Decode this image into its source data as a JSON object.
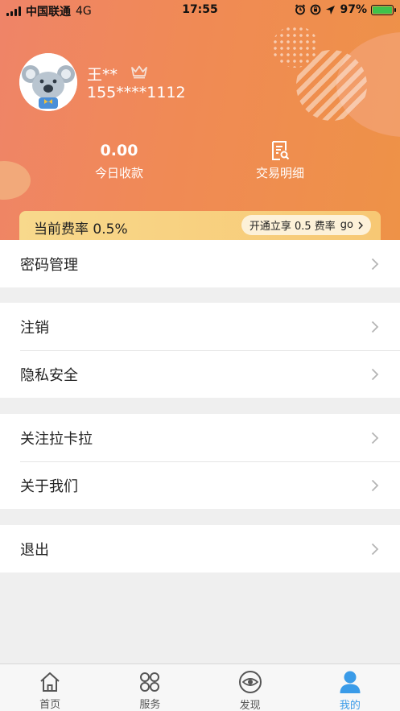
{
  "status_bar": {
    "carrier": "中国联通",
    "network": "4G",
    "time": "17:55",
    "battery": "97%"
  },
  "profile": {
    "name": "王**",
    "phone": "155****1112",
    "avatar_icon": "koala-avatar-icon",
    "vip_icon": "crown-icon"
  },
  "stats": {
    "today_amount": "0.00",
    "today_label": "今日收款",
    "detail_label": "交易明细",
    "detail_icon": "receipt-search-icon"
  },
  "rate": {
    "label": "当前费率 0.5%",
    "button": "开通立享 0.5 费率",
    "button_go": "go",
    "colors": {
      "bar": "#f8d98c",
      "button_bg": "#fdf1d8"
    }
  },
  "menu": {
    "password": "密码管理",
    "cancel_account": "注销",
    "privacy": "隐私安全",
    "follow": "关注拉卡拉",
    "about": "关于我们",
    "logout": "退出"
  },
  "tabs": [
    {
      "label": "首页",
      "icon": "home-icon"
    },
    {
      "label": "服务",
      "icon": "services-icon"
    },
    {
      "label": "发现",
      "icon": "discover-eye-icon"
    },
    {
      "label": "我的",
      "icon": "user-icon",
      "active": true
    }
  ],
  "colors": {
    "header_start": "#ef8468",
    "header_end": "#ee9247",
    "tab_active": "#3a9be8",
    "background": "#efefef"
  }
}
